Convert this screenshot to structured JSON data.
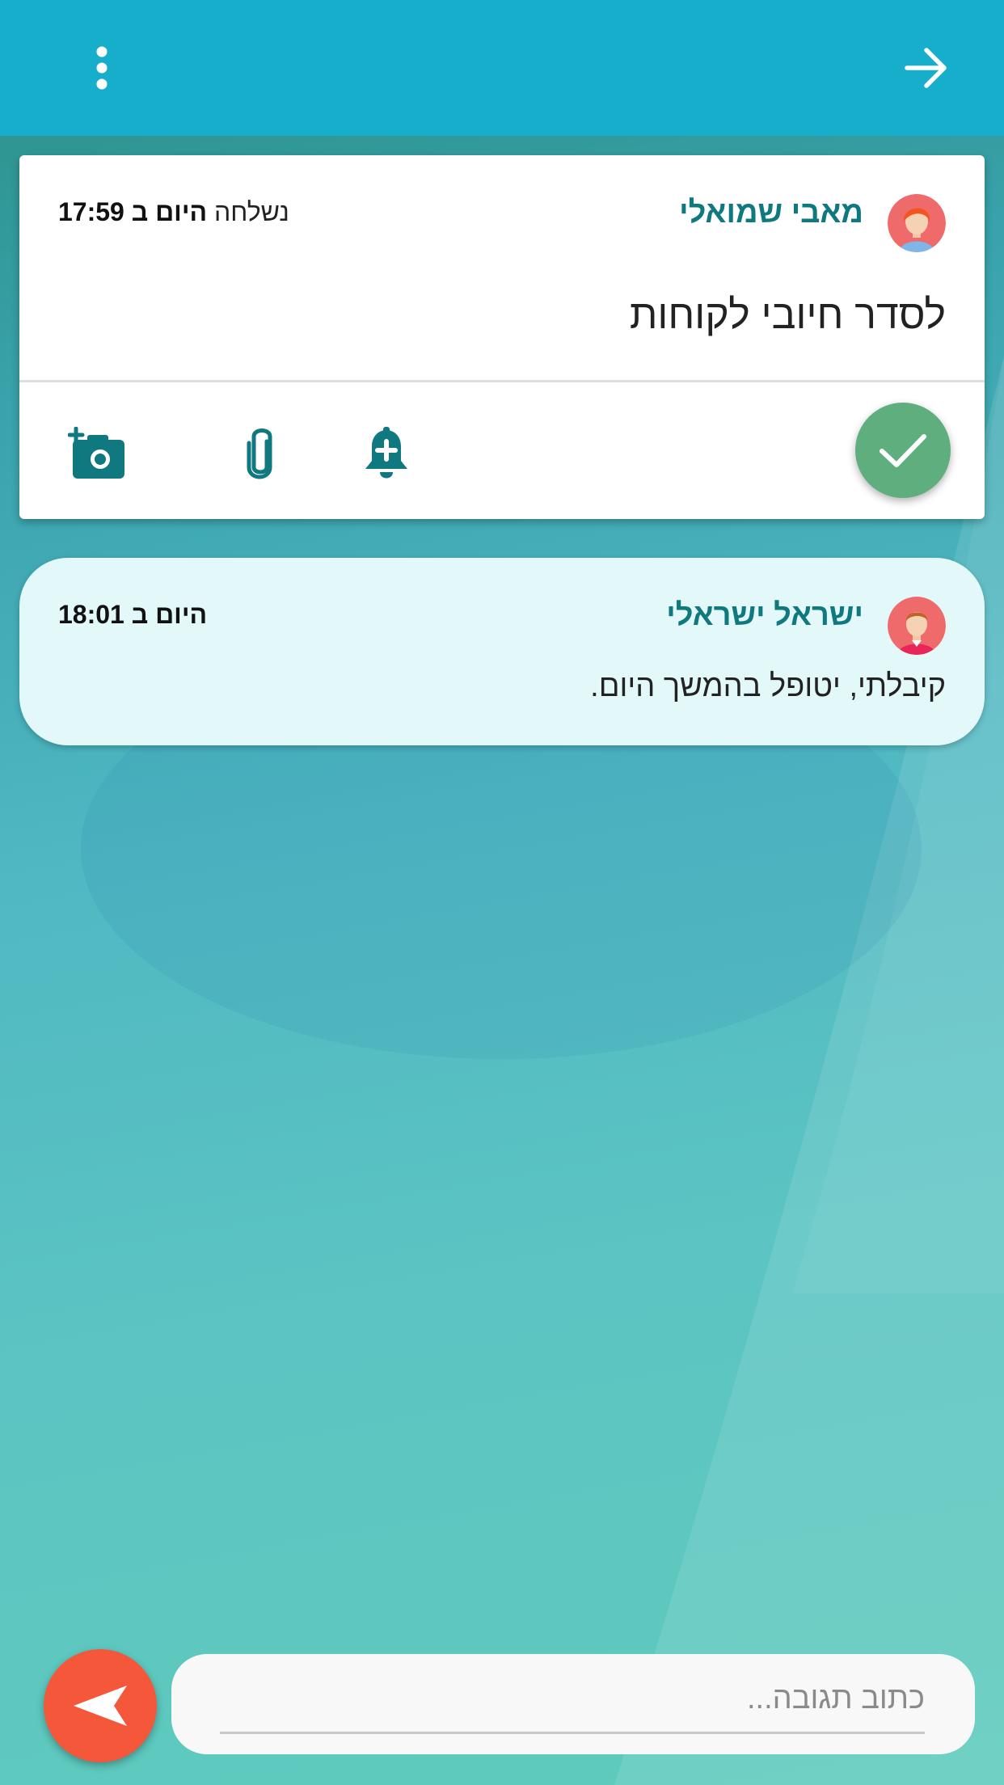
{
  "colors": {
    "topbar": "#17aecb",
    "accent_teal": "#10797f",
    "check_green": "#5fae7d",
    "send_orange": "#f4573a",
    "reply_bubble": "#e2f8f9"
  },
  "topbar": {
    "menu_icon": "more-vert-icon",
    "back_icon": "arrow-forward-icon"
  },
  "task": {
    "sender_name": "מאבי שמואלי",
    "sent_prefix": "נשלחה",
    "sent_day": "היום ב",
    "sent_time": "17:59",
    "text": "לסדר חיובי לקוחות",
    "actions": {
      "camera_icon": "add-photo-icon",
      "attach_icon": "paperclip-icon",
      "reminder_icon": "add-alert-icon",
      "complete_icon": "check-icon"
    }
  },
  "reply": {
    "sender_name": "ישראל ישראלי",
    "sent_day": "היום ב",
    "sent_time": "18:01",
    "text": "קיבלתי, יטופל בהמשך היום."
  },
  "composer": {
    "placeholder": "כתוב תגובה...",
    "value": "",
    "send_icon": "send-icon"
  }
}
